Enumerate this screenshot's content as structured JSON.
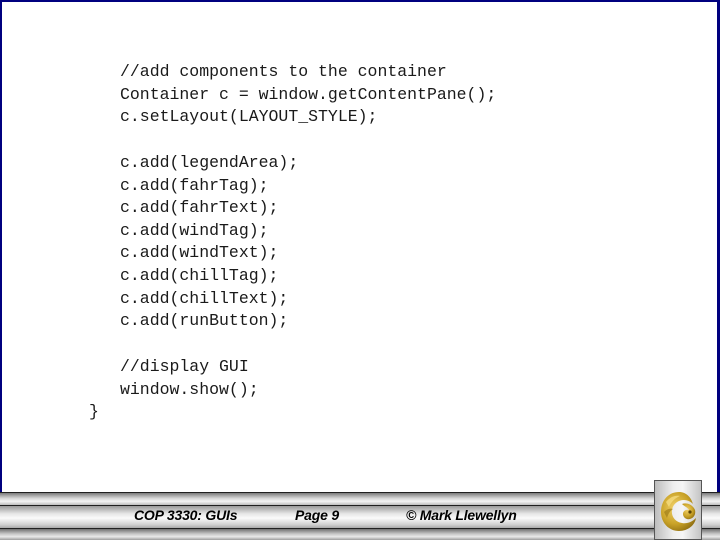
{
  "slide": {
    "code_block_1": [
      "//add components to the container",
      "Container c = window.getContentPane();",
      "c.setLayout(LAYOUT_STYLE);"
    ],
    "code_block_2": [
      "c.add(legendArea);",
      "c.add(fahrTag);",
      "c.add(fahrText);",
      "c.add(windTag);",
      "c.add(windText);",
      "c.add(chillTag);",
      "c.add(chillText);",
      "c.add(runButton);"
    ],
    "code_block_3": [
      "//display GUI",
      "window.show();"
    ],
    "closing_brace": "}"
  },
  "footer": {
    "course": "COP 3330:  GUIs",
    "page": "Page 9",
    "author": "© Mark Llewellyn",
    "logo_icon": "pegasus-logo-icon"
  },
  "colors": {
    "frame_border": "#00007f",
    "logo_gold": "#c9a227"
  }
}
